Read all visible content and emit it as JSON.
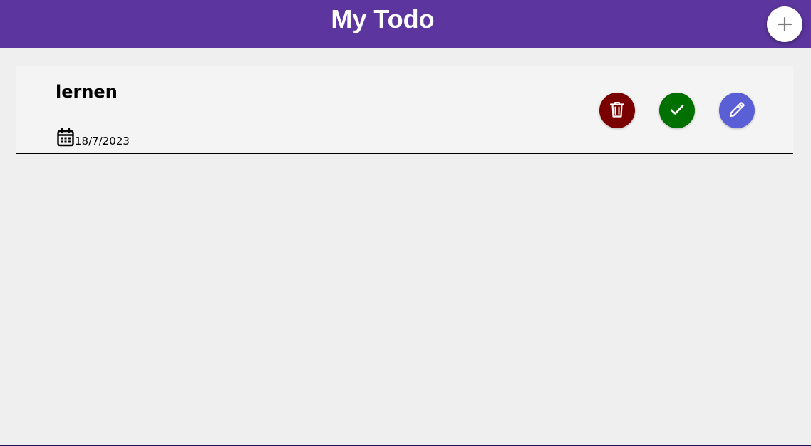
{
  "header": {
    "title": "My Todo",
    "add_icon": "plus-icon"
  },
  "todos": [
    {
      "title": "lernen",
      "date": "18/7/2023",
      "date_icon": "calendar-icon",
      "actions": {
        "delete": {
          "icon": "trash-icon",
          "color": "#7a0000"
        },
        "complete": {
          "icon": "check-icon",
          "color": "#007000"
        },
        "edit": {
          "icon": "pencil-icon",
          "color": "#5a5fd6"
        }
      }
    }
  ],
  "colors": {
    "header_bg": "#5c369e",
    "page_bg": "#efefef",
    "card_bg": "#f4f4f4"
  }
}
